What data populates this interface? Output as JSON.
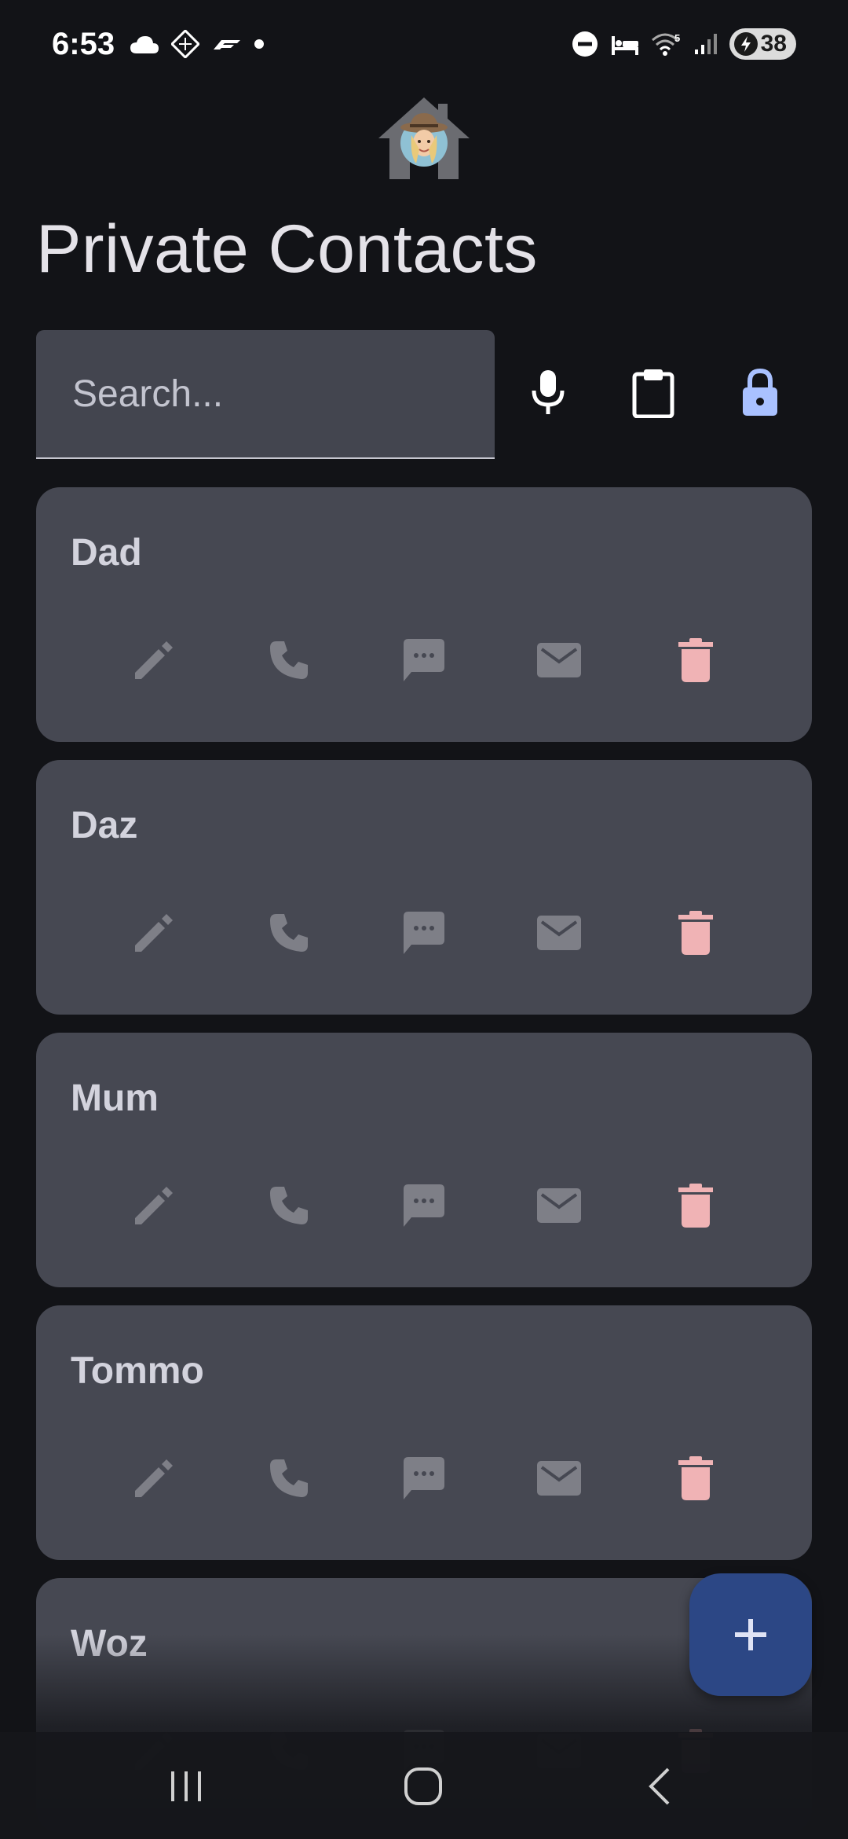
{
  "status_bar": {
    "time": "6:53",
    "battery": "38",
    "network_label": "5"
  },
  "app": {
    "title": "Private Contacts",
    "logo_icon": "house-avatar-icon"
  },
  "search": {
    "placeholder": "Search...",
    "value": ""
  },
  "toolbar": {
    "mic_icon": "microphone-icon",
    "clipboard_icon": "clipboard-icon",
    "lock_icon": "lock-icon",
    "lock_color": "#a9c1ff"
  },
  "contacts": [
    {
      "name": "Dad"
    },
    {
      "name": "Daz"
    },
    {
      "name": "Mum"
    },
    {
      "name": "Tommo"
    },
    {
      "name": "Woz"
    }
  ],
  "card_actions": [
    "edit-icon",
    "phone-icon",
    "message-icon",
    "email-icon",
    "delete-icon"
  ],
  "colors": {
    "background": "#121317",
    "card": "#464852",
    "action_icon": "#7e7f87",
    "delete_icon": "#f0b3b5",
    "fab": "#2c4785"
  },
  "fab": {
    "icon": "plus-icon"
  },
  "nav_bar": {
    "items": [
      "recent-apps-icon",
      "home-icon",
      "back-icon"
    ]
  }
}
